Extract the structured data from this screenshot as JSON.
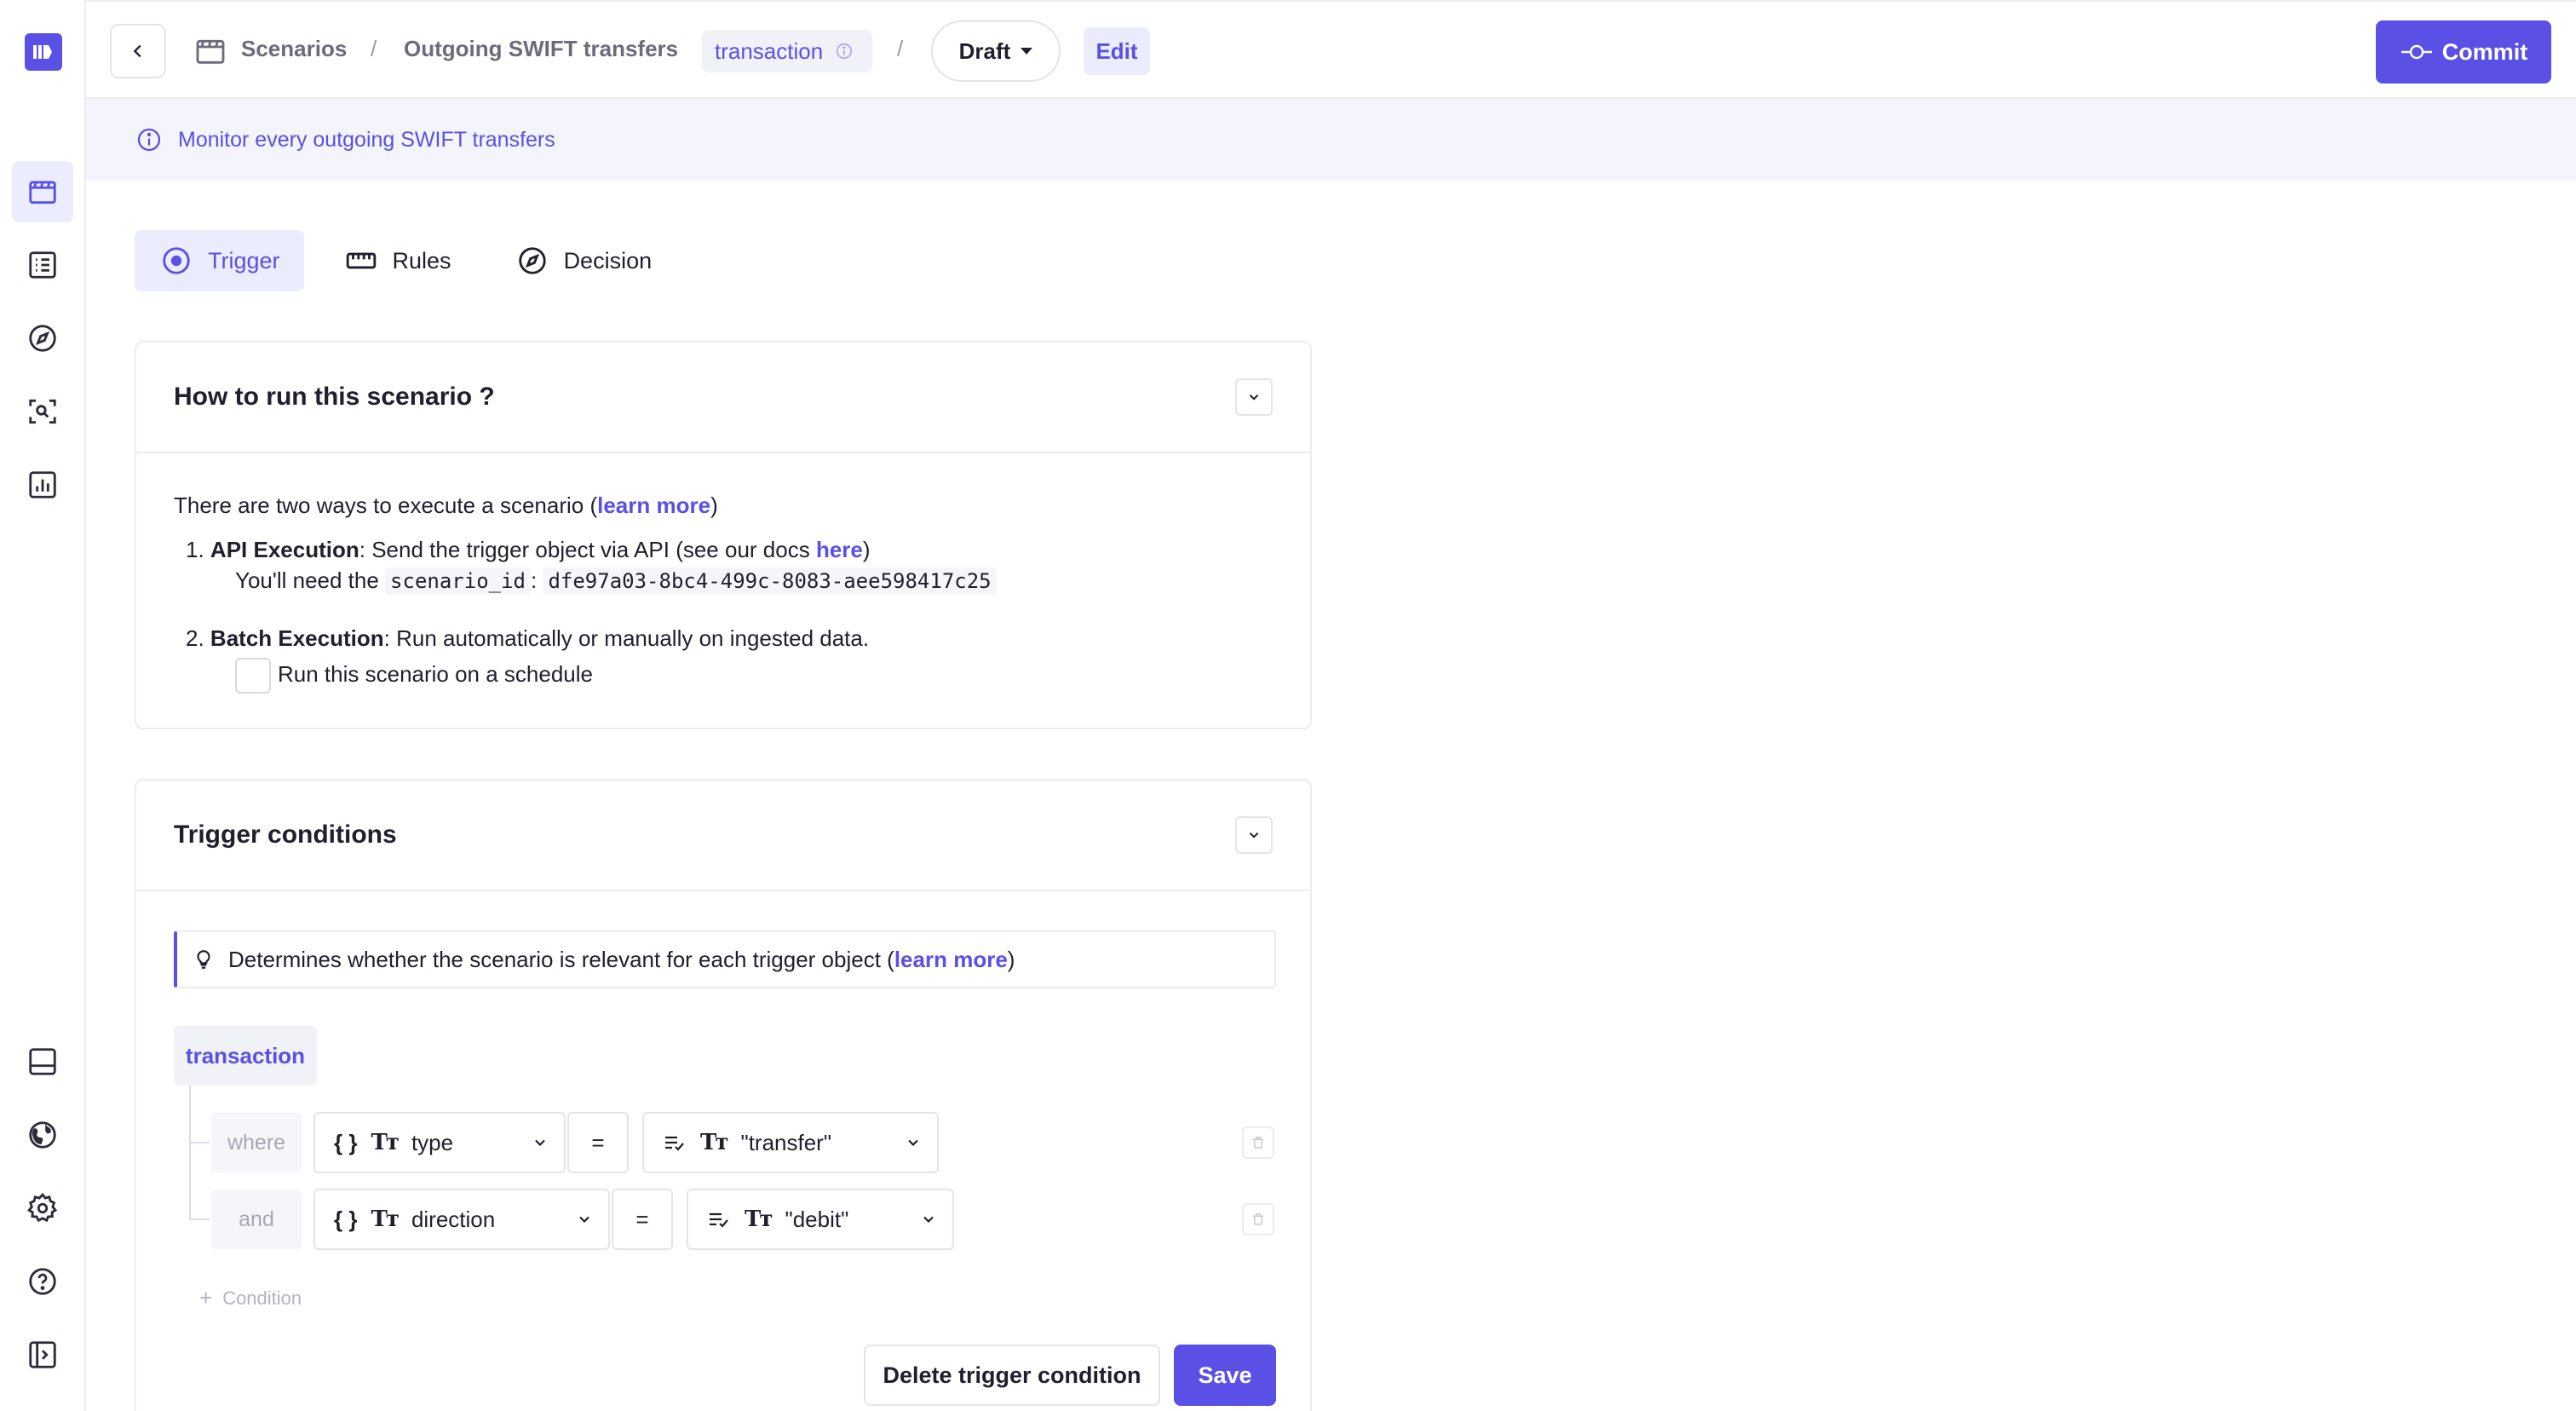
{
  "header": {
    "breadcrumbs": [
      "Scenarios",
      "Outgoing SWIFT transfers"
    ],
    "separator": "/",
    "trigger_object": "transaction",
    "version": "Draft",
    "mode": "Edit",
    "commit_label": "Commit"
  },
  "banner": {
    "text": "Monitor every outgoing SWIFT transfers"
  },
  "tabs": [
    {
      "label": "Trigger",
      "icon": "trigger-icon",
      "active": true
    },
    {
      "label": "Rules",
      "icon": "ruler-icon",
      "active": false
    },
    {
      "label": "Decision",
      "icon": "compass-icon",
      "active": false
    }
  ],
  "how_to_run": {
    "title": "How to run this scenario ?",
    "intro_prefix": "There are two ways to execute a scenario (",
    "intro_link": "learn more",
    "intro_suffix": ")",
    "api": {
      "number": "1.",
      "title": "API Execution",
      "text_prefix": ": Send the trigger object via API (see our docs ",
      "link": "here",
      "text_suffix": ")",
      "need_prefix": "You'll need the ",
      "id_key": "scenario_id",
      "id_sep": ": ",
      "id_value": "dfe97a03-8bc4-499c-8083-aee598417c25"
    },
    "batch": {
      "number": "2.",
      "title": "Batch Execution",
      "text": ": Run automatically or manually on ingested data.",
      "checkbox_label": "Run this scenario on a schedule",
      "checked": false
    }
  },
  "trigger_conditions": {
    "title": "Trigger conditions",
    "hint_prefix": "Determines whether the scenario is relevant for each trigger object (",
    "hint_link": "learn more",
    "hint_suffix": ")",
    "object": "transaction",
    "conditions": [
      {
        "keyword": "where",
        "field": "type",
        "operator": "=",
        "value": "\"transfer\""
      },
      {
        "keyword": "and",
        "field": "direction",
        "operator": "=",
        "value": "\"debit\""
      }
    ],
    "add_condition": "Condition",
    "delete_label": "Delete trigger condition",
    "save_label": "Save"
  },
  "colors": {
    "accent": "#5a50e5",
    "accent_light": "#ececff",
    "banner_bg": "#f4f4fc"
  }
}
